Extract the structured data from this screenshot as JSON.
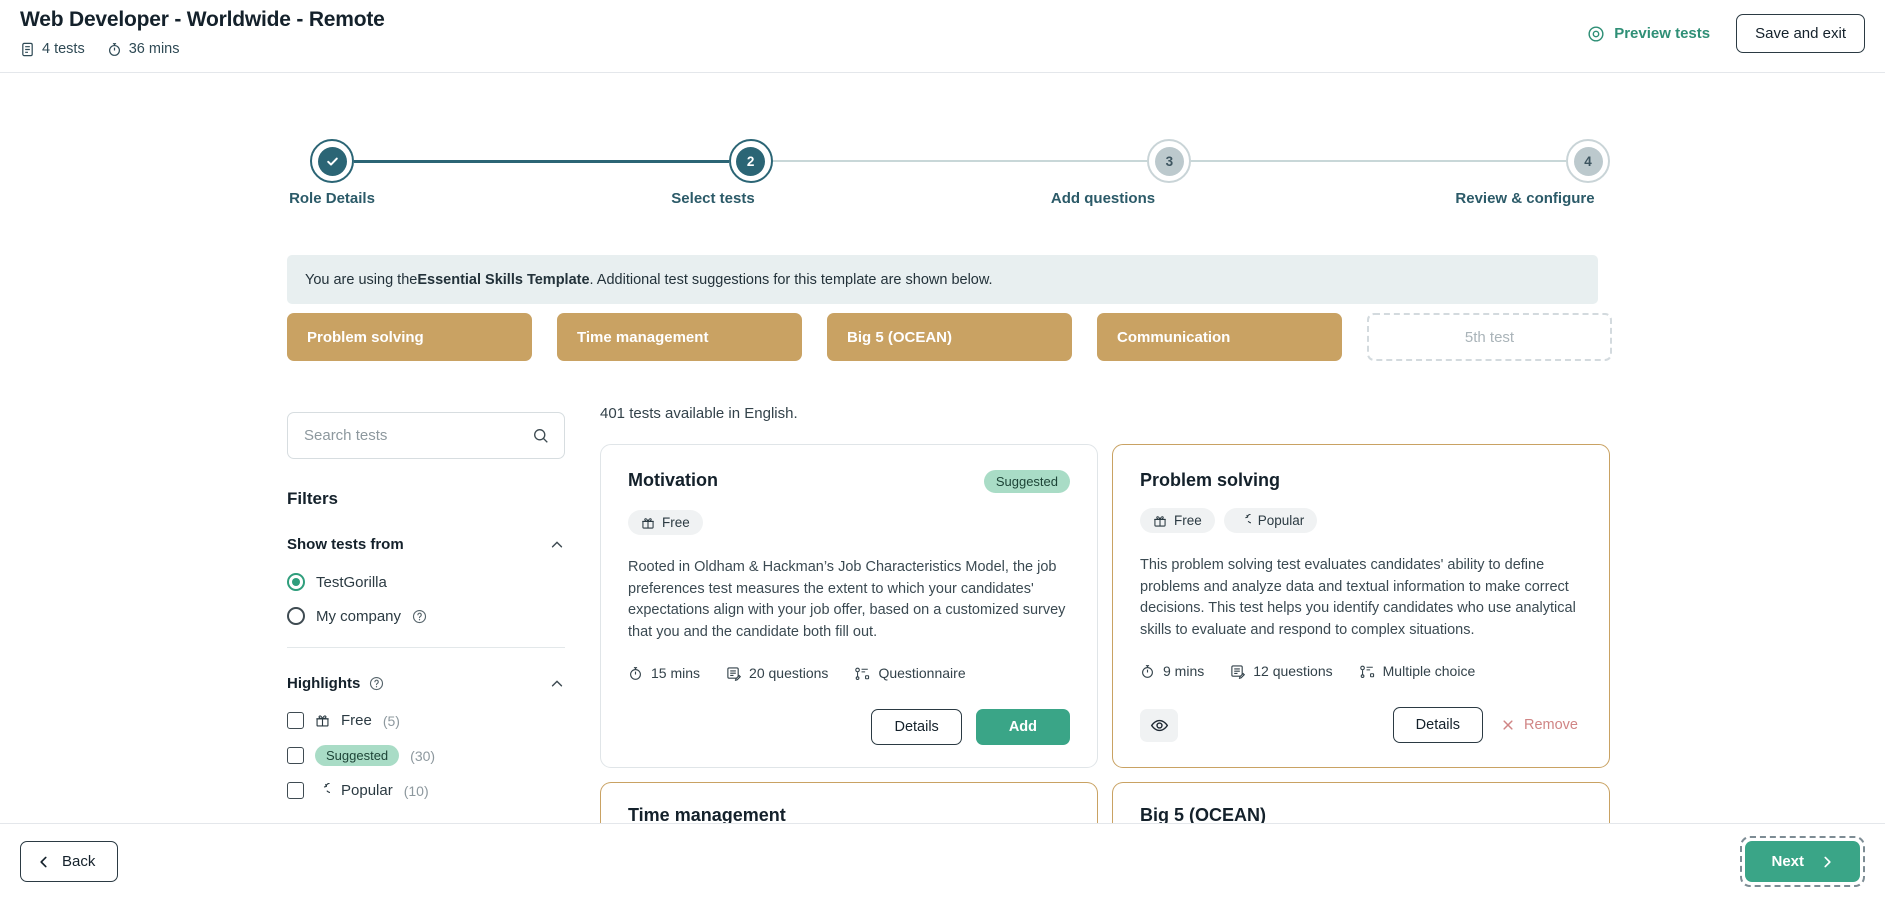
{
  "header": {
    "job_title": "Web Developer - Worldwide - Remote",
    "meta": [
      {
        "icon": "tests-icon",
        "label": "4 tests"
      },
      {
        "icon": "timer-icon",
        "label": "36 mins"
      }
    ],
    "preview_tests_label": "Preview tests",
    "preview_icon": "eye-target-icon",
    "save_and_exit_label": "Save and exit"
  },
  "stepper": {
    "steps": [
      {
        "number": "1",
        "label": "Role Details",
        "state": "complete"
      },
      {
        "number": "2",
        "label": "Select tests",
        "state": "current"
      },
      {
        "number": "3",
        "label": "Add questions",
        "state": "upcoming"
      },
      {
        "number": "4",
        "label": "Review & configure",
        "state": "upcoming"
      }
    ]
  },
  "banner": {
    "prefix": "You are using the ",
    "template_name": "Essential Skills Template",
    "suffix": ". Additional test suggestions for this template are shown below."
  },
  "selected_chips": [
    {
      "label": "Problem solving",
      "empty": false
    },
    {
      "label": "Time management",
      "empty": false
    },
    {
      "label": "Big 5 (OCEAN)",
      "empty": false
    },
    {
      "label": "Communication",
      "empty": false
    },
    {
      "label": "5th test",
      "empty": true
    }
  ],
  "sidebar": {
    "search": {
      "placeholder": "Search tests",
      "value": "",
      "icon": "search-icon"
    },
    "filters_title": "Filters",
    "groups": [
      {
        "title": "Show tests from",
        "has_help": false,
        "collapse_icon": "chevron-up-icon",
        "options": [
          {
            "type": "radio",
            "label": "TestGorilla",
            "checked": true,
            "help": false
          },
          {
            "type": "radio",
            "label": "My company",
            "checked": false,
            "help": true
          }
        ]
      },
      {
        "title": "Highlights",
        "has_help": true,
        "collapse_icon": "chevron-up-icon",
        "options": [
          {
            "type": "checkbox",
            "label": "Free",
            "count": "(5)",
            "icon": "gift-icon",
            "pill": false
          },
          {
            "type": "checkbox",
            "label": "Suggested",
            "count": "(30)",
            "icon": "",
            "pill": true
          },
          {
            "type": "checkbox",
            "label": "Popular",
            "count": "(10)",
            "icon": "popular-icon",
            "pill": false
          }
        ]
      }
    ]
  },
  "results": {
    "count_text": "401 tests available in English.",
    "cards": [
      {
        "title": "Motivation",
        "badge": "Suggested",
        "selected": false,
        "tags": [
          {
            "label": "Free",
            "icon": "gift-icon"
          }
        ],
        "description": "Rooted in Oldham & Hackman’s Job Characteristics Model, the job preferences test measures the extent to which your candidates' expectations align with your job offer, based on a customized survey that you and the candidate both fill out.",
        "stats": [
          {
            "icon": "timer-icon",
            "label": "15 mins"
          },
          {
            "icon": "questions-icon",
            "label": "20 questions"
          },
          {
            "icon": "type-icon",
            "label": "Questionnaire"
          }
        ],
        "has_eye": false,
        "details_label": "Details",
        "primary_label": "Add",
        "primary_action": "add"
      },
      {
        "title": "Problem solving",
        "badge": "",
        "selected": true,
        "tags": [
          {
            "label": "Free",
            "icon": "gift-icon"
          },
          {
            "label": "Popular",
            "icon": "popular-icon"
          }
        ],
        "description": "This problem solving test evaluates candidates' ability to define problems and analyze data and textual information to make correct decisions. This test helps you identify candidates who use analytical skills to evaluate and respond to complex situations.",
        "stats": [
          {
            "icon": "timer-icon",
            "label": "9 mins"
          },
          {
            "icon": "questions-icon",
            "label": "12 questions"
          },
          {
            "icon": "type-icon",
            "label": "Multiple choice"
          }
        ],
        "has_eye": true,
        "eye_icon": "eye-icon",
        "details_label": "Details",
        "primary_label": "Remove",
        "primary_action": "remove"
      }
    ],
    "partial_cards": [
      {
        "title": "Time management",
        "selected": true
      },
      {
        "title": "Big 5 (OCEAN)",
        "selected": true
      }
    ]
  },
  "footer": {
    "back_label": "Back",
    "back_icon": "chevron-left-icon",
    "next_label": "Next",
    "next_icon": "chevron-right-icon"
  },
  "colors": {
    "accent_green": "#3aa587",
    "link_green": "#2f8f76",
    "step_teal": "#2b6575",
    "chip_gold": "#c9a263",
    "card_selected_border": "#c9a263",
    "badge_suggested_bg": "#a9dcc6",
    "remove_red": "#d08585",
    "banner_bg": "#e8eff0"
  }
}
